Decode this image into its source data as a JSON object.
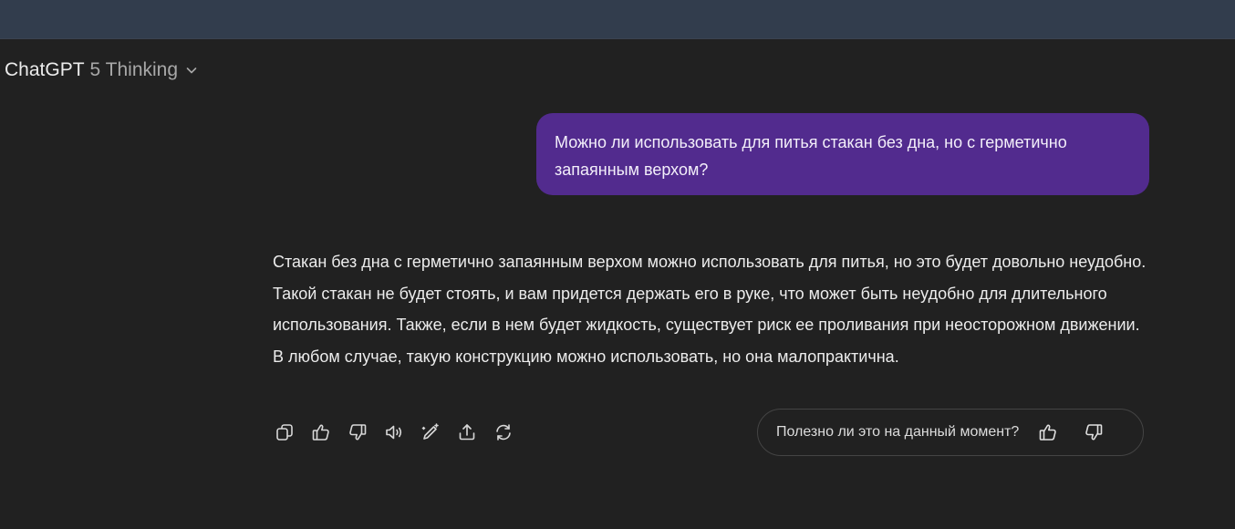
{
  "header": {
    "brand": "ChatGPT",
    "model": "5 Thinking",
    "icon": "chevron-down-icon"
  },
  "conversation": {
    "user_message": "Можно ли использовать для питья стакан без дна, но с герметично запаянным верхом?",
    "assistant_message": "Стакан без дна с герметично запаянным верхом можно использовать для питья, но это будет довольно неудобно. Такой стакан не будет стоять, и вам придется держать его в руке, что может быть неудобно для длительного использования. Также, если в нем будет жидкость, существует риск ее проливания при неосторожном движении. В любом случае, такую конструкцию можно использовать, но она малопрактична."
  },
  "actions": {
    "icons": [
      "copy-icon",
      "thumbs-up-icon",
      "thumbs-down-icon",
      "read-aloud-icon",
      "edit-in-canvas-icon",
      "share-icon",
      "regenerate-icon"
    ]
  },
  "feedback": {
    "question": "Полезно ли это на данный момент?",
    "icons": [
      "thumbs-up-icon",
      "thumbs-down-icon"
    ]
  },
  "colors": {
    "topbar": "#323d4d",
    "background": "#212121",
    "user_bubble": "#522b8e",
    "text": "#ececec",
    "muted_text": "#a8a8a8"
  }
}
